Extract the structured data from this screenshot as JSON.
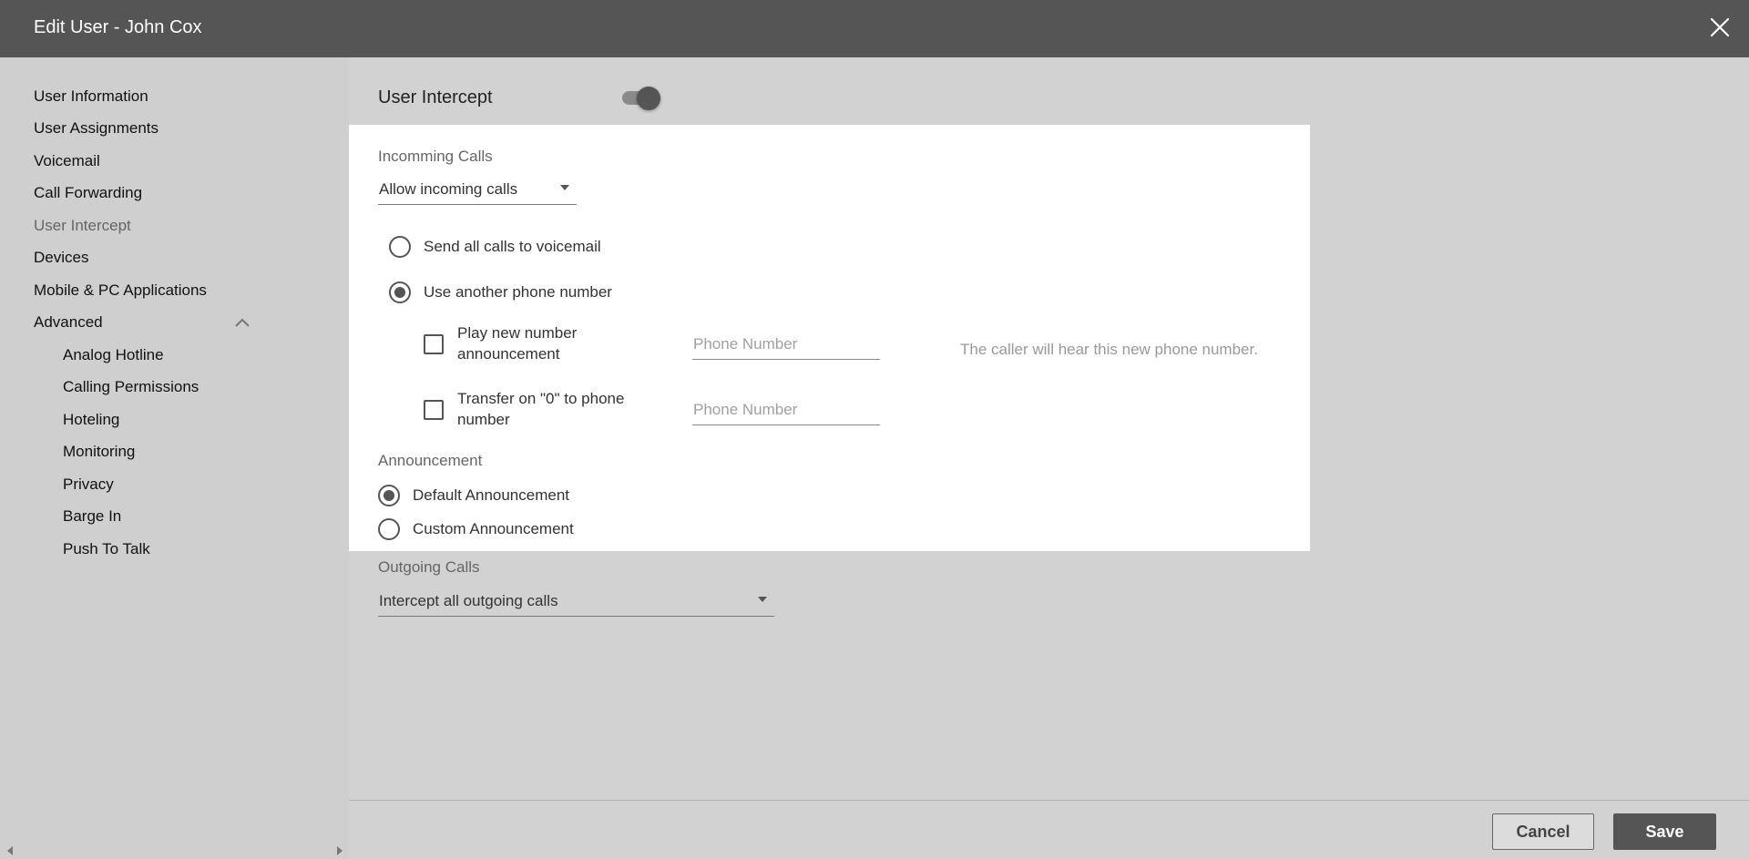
{
  "window": {
    "title": "Edit User - John Cox"
  },
  "sidebar": {
    "items": [
      {
        "label": "User Information"
      },
      {
        "label": "User Assignments"
      },
      {
        "label": "Voicemail"
      },
      {
        "label": "Call Forwarding"
      },
      {
        "label": "User Intercept"
      },
      {
        "label": "Devices"
      },
      {
        "label": "Mobile & PC Applications"
      },
      {
        "label": "Advanced"
      }
    ],
    "active": "User Intercept",
    "advanced_expanded": true,
    "subitems": [
      {
        "label": "Analog Hotline"
      },
      {
        "label": "Calling Permissions"
      },
      {
        "label": "Hoteling"
      },
      {
        "label": "Monitoring"
      },
      {
        "label": "Privacy"
      },
      {
        "label": "Barge In"
      },
      {
        "label": "Push To Talk"
      }
    ]
  },
  "main": {
    "user_intercept_label": "User Intercept",
    "user_intercept_enabled": true,
    "incoming": {
      "label": "Incomming Calls",
      "selected": "Allow incoming calls",
      "options": [
        {
          "label": "Send all calls to voicemail",
          "checked": false
        },
        {
          "label": "Use another phone number",
          "checked": true
        }
      ],
      "play_announcement": {
        "label": "Play new number announcement",
        "checked": false,
        "placeholder": "Phone Number"
      },
      "transfer_zero": {
        "label": "Transfer on \"0\" to phone number",
        "checked": false,
        "placeholder": "Phone Number"
      },
      "hint": "The caller will hear this new phone number."
    },
    "announcement": {
      "label": "Announcement",
      "options": [
        {
          "label": "Default Announcement",
          "checked": true
        },
        {
          "label": "Custom Announcement",
          "checked": false
        }
      ]
    },
    "outgoing": {
      "label": "Outgoing Calls",
      "selected": "Intercept all outgoing calls"
    }
  },
  "footer": {
    "cancel_label": "Cancel",
    "save_label": "Save"
  },
  "colors": {
    "header": "#555555",
    "sidebar": "#cfcfcf",
    "content": "#d2d2d2",
    "card": "#ffffff",
    "accent": "#555555"
  }
}
